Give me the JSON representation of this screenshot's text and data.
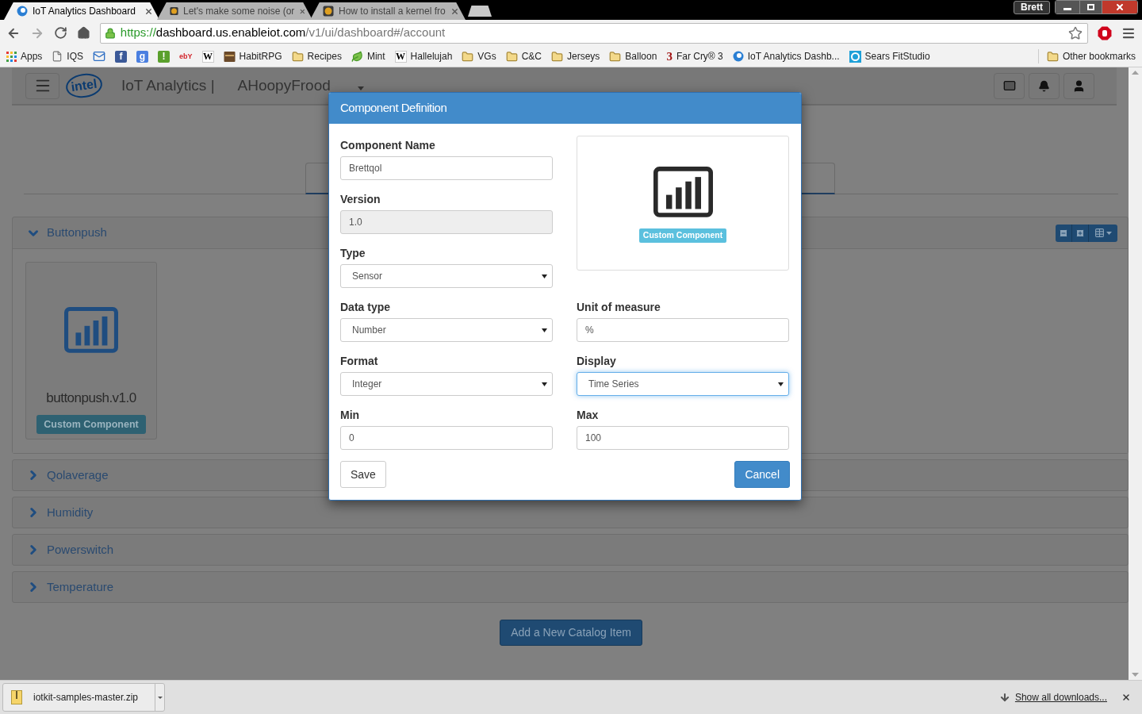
{
  "browser": {
    "tabs": [
      {
        "title": "IoT Analytics Dashboard",
        "selected": true
      },
      {
        "title": "Let's make some noise (or",
        "selected": false
      },
      {
        "title": "How to install a kernel fro",
        "selected": false
      }
    ],
    "profile": "Brett",
    "url": {
      "scheme": "https://",
      "host": "dashboard.us.enableiot.com",
      "path": "/v1/ui/dashboard#/account"
    },
    "bookmarks": [
      {
        "kind": "link",
        "label": "Apps"
      },
      {
        "kind": "link",
        "label": "IQS"
      },
      {
        "kind": "icon"
      },
      {
        "kind": "icon",
        "glyph": "f",
        "color": "#3b5998"
      },
      {
        "kind": "icon",
        "glyph": "g",
        "color": "#4a7fe0"
      },
      {
        "kind": "icon",
        "glyph": "!",
        "color": "#5aa02c"
      },
      {
        "kind": "icon",
        "glyph": "ebY"
      },
      {
        "kind": "icon",
        "glyph": "W"
      },
      {
        "kind": "link",
        "label": "HabitRPG"
      },
      {
        "kind": "link",
        "label": "Recipes"
      },
      {
        "kind": "link",
        "label": "Mint"
      },
      {
        "kind": "link",
        "label": "Hallelujah",
        "glyph": "W"
      },
      {
        "kind": "link",
        "label": "VGs"
      },
      {
        "kind": "link",
        "label": "C&C"
      },
      {
        "kind": "link",
        "label": "Jerseys"
      },
      {
        "kind": "link",
        "label": "Balloon"
      },
      {
        "kind": "link",
        "label": "Far Cry® 3",
        "glyph": "3"
      },
      {
        "kind": "link",
        "label": "IoT Analytics Dashb..."
      },
      {
        "kind": "link",
        "label": "Sears FitStudio"
      }
    ],
    "other_bookmarks": "Other bookmarks"
  },
  "page": {
    "logo": "intel",
    "app_title": "IoT Analytics |",
    "account": "AHoopyFrood",
    "panels": [
      {
        "title": "Buttonpush",
        "expanded": true,
        "cards": [
          {
            "title": "buttonpush.v1.0",
            "badge": "Custom Component"
          }
        ]
      },
      {
        "title": "Qolaverage",
        "expanded": false
      },
      {
        "title": "Humidity",
        "expanded": false
      },
      {
        "title": "Powerswitch",
        "expanded": false
      },
      {
        "title": "Temperature",
        "expanded": false
      }
    ],
    "add_button": "Add a New Catalog Item"
  },
  "modal": {
    "title": "Component Definition",
    "top_fields": [
      {
        "label": "Component Name",
        "value": "Brettqol",
        "kind": "text",
        "focused": false
      },
      {
        "label": "Version",
        "value": "1.0",
        "kind": "readonly",
        "focused": false
      },
      {
        "label": "Type",
        "value": "Sensor",
        "kind": "select",
        "focused": false
      }
    ],
    "preview": {
      "badge": "Custom Component"
    },
    "rows": [
      [
        {
          "label": "Data type",
          "value": "Number",
          "kind": "select",
          "focused": false
        },
        {
          "label": "Unit of measure",
          "value": "%",
          "kind": "text",
          "focused": false
        }
      ],
      [
        {
          "label": "Format",
          "value": "Integer",
          "kind": "select",
          "focused": false
        },
        {
          "label": "Display",
          "value": "Time Series",
          "kind": "select",
          "focused": true
        }
      ],
      [
        {
          "label": "Min",
          "value": "0",
          "kind": "text",
          "focused": false
        },
        {
          "label": "Max",
          "value": "100",
          "kind": "text",
          "focused": false
        }
      ]
    ],
    "buttons": [
      {
        "label": "Save",
        "kind": "default"
      },
      {
        "label": "Cancel",
        "kind": "primary"
      }
    ]
  },
  "downloads": {
    "file": "iotkit-samples-master.zip",
    "show_all": "Show all downloads..."
  }
}
